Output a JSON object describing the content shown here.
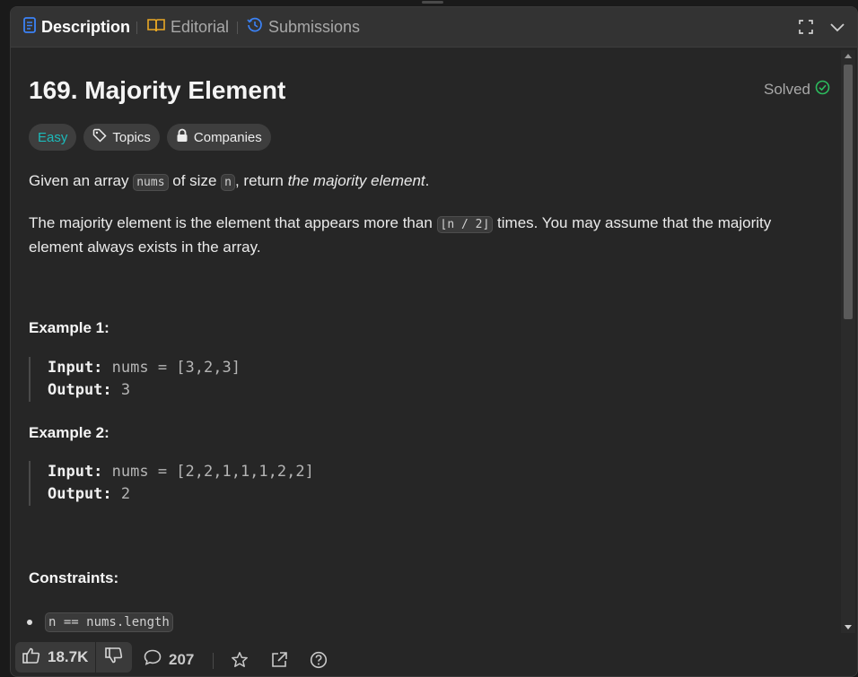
{
  "tabs": {
    "description": "Description",
    "editorial": "Editorial",
    "submissions": "Submissions"
  },
  "problem": {
    "title": "169. Majority Element",
    "status": "Solved",
    "difficulty": "Easy",
    "topics_label": "Topics",
    "companies_label": "Companies",
    "para1": {
      "t1": "Given an array ",
      "code1": "nums",
      "t2": " of size ",
      "code2": "n",
      "t3": ", return ",
      "em": "the majority element",
      "t4": "."
    },
    "para2": {
      "t1": "The majority element is the element that appears more than ",
      "code1": "⌊n / 2⌋",
      "t2": " times. You may assume that the majority element always exists in the array."
    },
    "examples": [
      {
        "heading": "Example 1:",
        "input_label": "Input:",
        "input_value": " nums = [3,2,3]",
        "output_label": "Output:",
        "output_value": " 3"
      },
      {
        "heading": "Example 2:",
        "input_label": "Input:",
        "input_value": " nums = [2,2,1,1,1,2,2]",
        "output_label": "Output:",
        "output_value": " 2"
      }
    ],
    "constraints_heading": "Constraints:",
    "constraints": [
      "n == nums.length"
    ]
  },
  "footer": {
    "likes": "18.7K",
    "comments": "207"
  },
  "colors": {
    "accent_blue": "#3b82f6",
    "easy": "#1cbaba",
    "solved_green": "#2cbb5d",
    "editorial_icon": "#e9a825",
    "panel_bg": "#262626"
  },
  "icons": [
    "description-icon",
    "editorial-book-icon",
    "submissions-history-icon",
    "fullscreen-icon",
    "chevron-down-icon",
    "check-circle-icon",
    "tag-icon",
    "lock-icon",
    "thumbs-up-icon",
    "thumbs-down-icon",
    "comment-icon",
    "star-icon",
    "share-icon",
    "help-icon"
  ]
}
